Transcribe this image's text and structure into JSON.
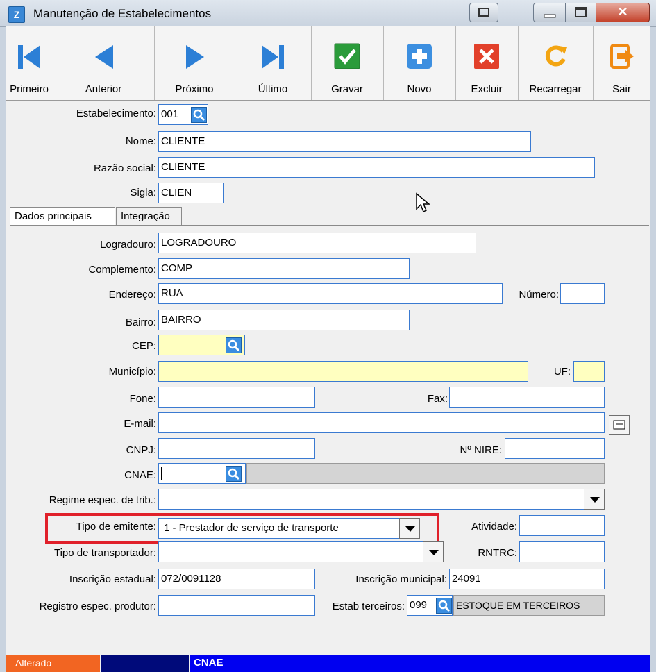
{
  "window": {
    "title": "Manutenção de Estabelecimentos",
    "app_icon": "Z"
  },
  "toolbar": {
    "first": "Primeiro",
    "previous": "Anterior",
    "next": "Próximo",
    "last": "Último",
    "save": "Gravar",
    "new": "Novo",
    "delete": "Excluir",
    "reload": "Recarregar",
    "exit": "Sair"
  },
  "form": {
    "estabelecimento_label": "Estabelecimento:",
    "estabelecimento_value": "001",
    "nome_label": "Nome:",
    "nome_value": "CLIENTE",
    "razao_label": "Razão social:",
    "razao_value": "CLIENTE",
    "sigla_label": "Sigla:",
    "sigla_value": "CLIEN"
  },
  "tabs": {
    "main": "Dados principais",
    "integration": "Integração"
  },
  "address": {
    "logradouro_label": "Logradouro:",
    "logradouro_value": "LOGRADOURO",
    "complemento_label": "Complemento:",
    "complemento_value": "COMP",
    "endereco_label": "Endereço:",
    "endereco_value": "RUA",
    "numero_label": "Número:",
    "bairro_label": "Bairro:",
    "bairro_value": "BAIRRO",
    "cep_label": "CEP:",
    "municipio_label": "Município:",
    "uf_label": "UF:",
    "fone_label": "Fone:",
    "fax_label": "Fax:",
    "email_label": "E-mail:",
    "cnpj_label": "CNPJ:",
    "nire_label": "Nº NIRE:",
    "cnae_label": "CNAE:",
    "regime_label": "Regime espec. de trib.:",
    "tipo_emitente_label": "Tipo de emitente:",
    "tipo_emitente_value": "1 - Prestador de serviço de transporte",
    "atividade_label": "Atividade:",
    "tipo_transportador_label": "Tipo de transportador:",
    "rntrc_label": "RNTRC:",
    "ie_label": "Inscrição estadual:",
    "ie_value": "072/0091128",
    "im_label": "Inscrição municipal:",
    "im_value": "24091",
    "registro_label": "Registro espec. produtor:",
    "estab_terceiros_label": "Estab terceiros:",
    "estab_terceiros_value": "099",
    "estab_terceiros_desc": "ESTOQUE EM TERCEIROS"
  },
  "status": {
    "state": "Alterado",
    "field": "CNAE"
  },
  "colors": {
    "highlight": "#e0202a",
    "required": "#ffffc0",
    "status_state": "#f26522",
    "status_field": "#0000f0"
  }
}
